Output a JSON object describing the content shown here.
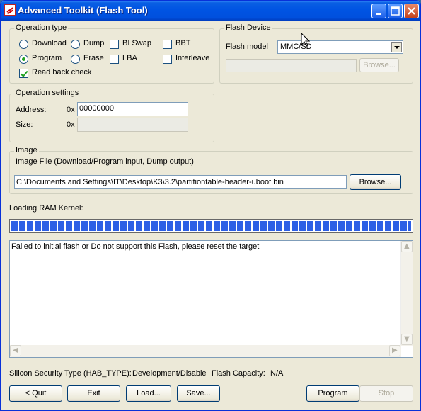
{
  "window": {
    "title": "Advanced Toolkit (Flash Tool)"
  },
  "operation_type": {
    "legend": "Operation type",
    "options": [
      {
        "label": "Download",
        "type": "radio",
        "checked": false
      },
      {
        "label": "Dump",
        "type": "radio",
        "checked": false
      },
      {
        "label": "BI Swap",
        "type": "checkbox",
        "checked": false
      },
      {
        "label": "BBT",
        "type": "checkbox",
        "checked": false
      },
      {
        "label": "Program",
        "type": "radio",
        "checked": true
      },
      {
        "label": "Erase",
        "type": "radio",
        "checked": false
      },
      {
        "label": "LBA",
        "type": "checkbox",
        "checked": false
      },
      {
        "label": "Interleave",
        "type": "checkbox",
        "checked": false
      }
    ],
    "read_back_check": {
      "label": "Read back check",
      "checked": true
    }
  },
  "flash_device": {
    "legend": "Flash Device",
    "model_label": "Flash model",
    "model_value": "MMC/SD",
    "browse_label": "Browse..."
  },
  "operation_settings": {
    "legend": "Operation settings",
    "address_label": "Address:",
    "address_prefix": "0x",
    "address_value": "00000000",
    "size_label": "Size:",
    "size_prefix": "0x",
    "size_value": ""
  },
  "image": {
    "legend": "Image",
    "file_label": "Image File (Download/Program input, Dump output)",
    "file_path": "C:\\Documents and Settings\\IT\\Desktop\\K3\\3.2\\partitiontable-header-uboot.bin",
    "browse_label": "Browse..."
  },
  "status": {
    "loading_label": "Loading RAM Kernel:",
    "progress_fraction": 1.0,
    "log_text": "Failed to initial flash or Do not support this Flash, please reset the target"
  },
  "footer": {
    "hab_label": "Silicon Security Type (HAB_TYPE):",
    "hab_value": "Development/Disable",
    "capacity_label": "Flash Capacity:",
    "capacity_value": "N/A"
  },
  "buttons": {
    "quit": "< Quit",
    "exit": "Exit",
    "load": "Load...",
    "save": "Save...",
    "program": "Program",
    "stop": "Stop"
  }
}
